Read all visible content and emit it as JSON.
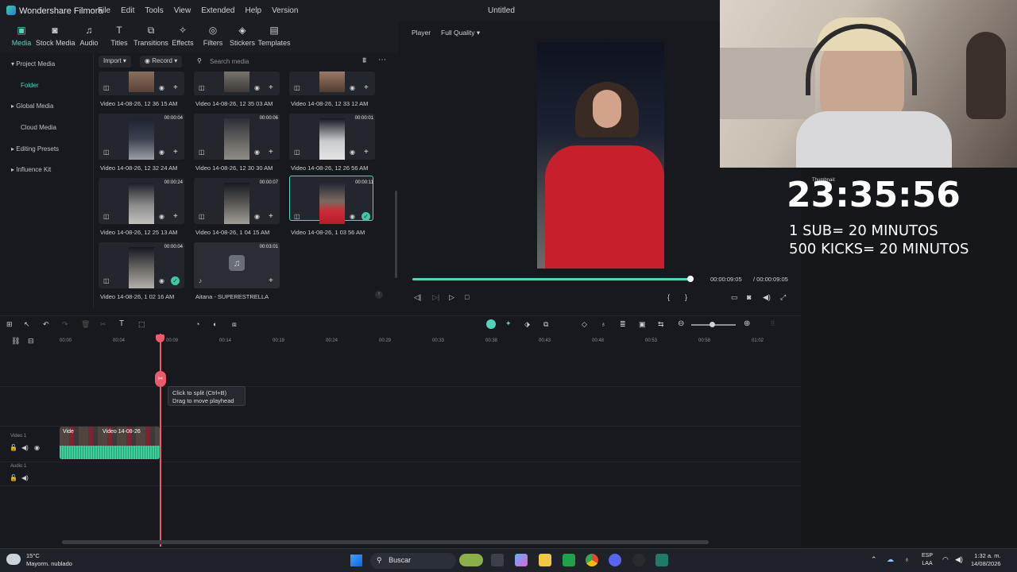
{
  "app": {
    "name": "Wondershare Filmora",
    "document_title": "Untitled",
    "menu": [
      "File",
      "Edit",
      "Tools",
      "View",
      "Extended",
      "Help",
      "Version"
    ]
  },
  "toolbar": {
    "tools": [
      {
        "label": "Media",
        "icon": "media-icon",
        "active": true
      },
      {
        "label": "Stock Media",
        "icon": "stock-media-icon"
      },
      {
        "label": "Audio",
        "icon": "audio-icon"
      },
      {
        "label": "Titles",
        "icon": "titles-icon"
      },
      {
        "label": "Transitions",
        "icon": "transitions-icon"
      },
      {
        "label": "Effects",
        "icon": "effects-icon"
      },
      {
        "label": "Filters",
        "icon": "filters-icon"
      },
      {
        "label": "Stickers",
        "icon": "stickers-icon"
      },
      {
        "label": "Templates",
        "icon": "templates-icon"
      }
    ]
  },
  "leftnav": {
    "items": [
      "Project Media",
      "Folder",
      "Global Media",
      "Cloud Media",
      "Editing Presets",
      "Influence Kit"
    ]
  },
  "mediabar": {
    "import_label": "Import",
    "record_label": "Record",
    "search_placeholder": "Search media"
  },
  "media": [
    {
      "caption": "Video 14-08-26, 12 36 15 AM",
      "duration": ""
    },
    {
      "caption": "Video 14-08-26, 12 35 03 AM",
      "duration": ""
    },
    {
      "caption": "Video 14-08-26, 12 33 12 AM",
      "duration": ""
    },
    {
      "caption": "Video 14-08-26, 12 32 24 AM",
      "duration": "00:00:04"
    },
    {
      "caption": "Video 14-08-26, 12 30 30 AM",
      "duration": "00:00:06"
    },
    {
      "caption": "Video 14-08-26, 12 26 56 AM",
      "duration": "00:00:01"
    },
    {
      "caption": "Video 14-08-26, 12 25 13 AM",
      "duration": "00:00:24"
    },
    {
      "caption": "Video 14-08-26, 1 04 15 AM",
      "duration": "00:00:07"
    },
    {
      "caption": "Video 14-08-26, 1 03 56 AM",
      "duration": "00:00:11"
    },
    {
      "caption": "Video 14-08-26, 1 02 16 AM",
      "duration": "00:00:04"
    },
    {
      "caption": "Aitana - SUPERESTRELLA",
      "duration": "00:03:01"
    }
  ],
  "player": {
    "tab": "Player",
    "quality": "Full Quality",
    "current_time": "00:00:09:05",
    "total_time": "/ 00:00:09:05",
    "progress": 1.0
  },
  "timeline": {
    "ticks": [
      "00:00",
      "00:04",
      "00:09",
      "00:14",
      "00:19",
      "00:24",
      "00:29",
      "00:33",
      "00:38",
      "00:43",
      "00:48",
      "00:53",
      "00:58",
      "01:02"
    ],
    "video_track_label": "Video 1",
    "audio_track_label": "Audio 1",
    "clip_label_1": "Vide",
    "clip_label_2": "Video 14-08-26",
    "tooltip_line1": "Click to split (Ctrl+B)",
    "tooltip_line2": "Drag to move playhead"
  },
  "overlay": {
    "thumbnail_label": "Thumbnail:",
    "timer": "23:35:56",
    "line1": "1 SUB= 20 MINUTOS",
    "line2": "500 KICKS= 20 MINUTOS"
  },
  "taskbar": {
    "temperature": "15°C",
    "weather": "Mayorm. nublado",
    "search_label": "Buscar",
    "lang": "ESP",
    "region": "LAA",
    "time": "1:32 a. m.",
    "date": "14/08/2026"
  },
  "colors": {
    "accent": "#4fd6b8",
    "playhead": "#ef5a6a"
  }
}
